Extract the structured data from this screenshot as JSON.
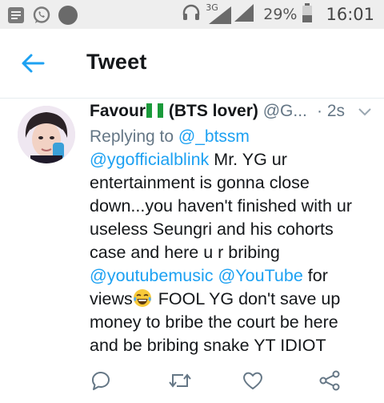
{
  "status_bar": {
    "network": "3G",
    "battery_percent": "29%",
    "time": "16:01",
    "icons": [
      "notes-app-icon",
      "whatsapp-icon",
      "circle-icon",
      "headphones-icon",
      "signal-icon",
      "battery-icon"
    ]
  },
  "appbar": {
    "title": "Tweet",
    "back_icon": "back-arrow-icon"
  },
  "tweet": {
    "author_name_prefix": "Favour",
    "author_name_suffix": "(BTS lover)",
    "handle": "@G...",
    "time": "· 2s",
    "reply_prefix": "Replying to",
    "reply_handle": "@_btssm",
    "lines": {
      "l1_link": "@ygofficialblink",
      "l1_text": " Mr. YG ur",
      "l2": "entertainment is gonna close",
      "l3": "down...you haven't finished with ur",
      "l4": "useless Seungri and his cohorts",
      "l5": "case and here u r bribing",
      "l6_link1": "@youtubemusic",
      "l6_link2": "@YouTube",
      "l6_text": " for",
      "l7_pre": "views",
      "l7_post": " FOOL YG don't save up",
      "l8": "money to bribe the court be here",
      "l9": "and be bribing snake YT IDIOT"
    },
    "actions": [
      "reply-icon",
      "retweet-icon",
      "like-icon",
      "share-icon"
    ]
  },
  "colors": {
    "accent": "#1da1f2",
    "text": "#14171a",
    "secondary": "#657786",
    "statusbar_bg": "#eeeeee"
  }
}
